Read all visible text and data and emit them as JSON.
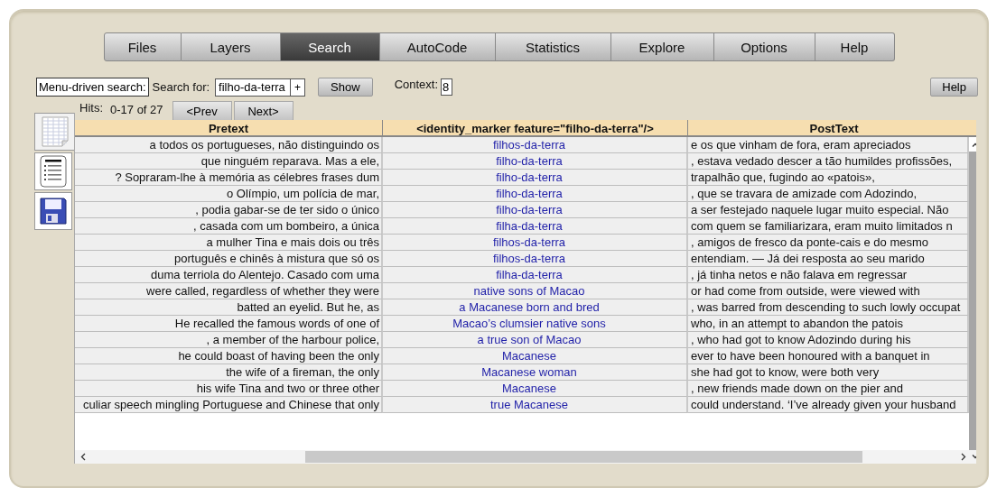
{
  "tabs": [
    {
      "label": "Files",
      "selected": false
    },
    {
      "label": "Layers",
      "selected": false
    },
    {
      "label": "Search",
      "selected": true
    },
    {
      "label": "AutoCode",
      "selected": false
    },
    {
      "label": "Statistics",
      "selected": false
    },
    {
      "label": "Explore",
      "selected": false
    },
    {
      "label": "Options",
      "selected": false
    },
    {
      "label": "Help",
      "selected": false
    }
  ],
  "search_bar": {
    "mode_button": "Menu-driven search:",
    "search_label": "Search for:",
    "search_value": "filho-da-terra",
    "add_button": "+",
    "show_button": "Show",
    "context_label": "Context:",
    "context_value": "8",
    "help_button": "Help"
  },
  "hits": {
    "label": "Hits:",
    "range": "0-17 of 27",
    "prev_button": "<Prev",
    "next_button": "Next>"
  },
  "table": {
    "columns": [
      "Pretext",
      "<identity_marker feature=\"filho-da-terra\"/>",
      "PostText"
    ],
    "rows": [
      [
        "a todos os portugueses, não distinguindo os",
        "filhos-da-terra",
        "e os que vinham de fora, eram apreciados"
      ],
      [
        "que ninguém reparava. Mas a ele,",
        "filho-da-terra",
        ", estava vedado descer a tão humildes profissões,"
      ],
      [
        "? Sopraram-lhe à memória as célebres frases dum",
        "filho-da-terra",
        "trapalhão que, fugindo ao «patois»,"
      ],
      [
        "o Olímpio, um polícia de mar,",
        "filho-da-terra",
        ", que se travara de amizade com Adozindo,"
      ],
      [
        ", podia gabar-se de ter sido o único",
        "filho-da-terra",
        "a ser festejado naquele lugar muito especial. Não"
      ],
      [
        ", casada com um bombeiro, a única",
        "filha-da-terra",
        "com quem se familiarizara, eram muito limitados n"
      ],
      [
        "a mulher Tina e mais dois ou três",
        "filhos-da-terra",
        ", amigos de fresco da ponte-cais e do mesmo"
      ],
      [
        "português e chinês à mistura que só os",
        "filhos-da-terra",
        "entendiam. — Já dei resposta ao seu marido"
      ],
      [
        "duma terriola do Alentejo. Casado com uma",
        "filha-da-terra",
        ", já tinha netos e não falava em regressar"
      ],
      [
        "were called, regardless of whether they were",
        "native sons of Macao",
        "or had come from outside, were viewed with"
      ],
      [
        "batted an eyelid. But he, as",
        "a Macanese born and bred",
        ", was barred from descending to such lowly occupat"
      ],
      [
        "He recalled the famous words of one of",
        "Macao’s clumsier native sons",
        "who, in an attempt to abandon the patois"
      ],
      [
        ", a member of the harbour police,",
        "a true son of Macao",
        ", who had got to know Adozindo during his"
      ],
      [
        "he could boast of having been the only",
        "Macanese",
        "ever to have been honoured with a banquet in"
      ],
      [
        "the wife of a fireman, the only",
        "Macanese woman",
        "she had got to know, were both very"
      ],
      [
        "his wife Tina and two or three other",
        "Macanese",
        ", new friends made down on the pier and"
      ],
      [
        "culiar speech mingling Portuguese and Chinese that only",
        "true Macanese",
        "could understand. ‘I’ve already given your husband"
      ]
    ]
  }
}
